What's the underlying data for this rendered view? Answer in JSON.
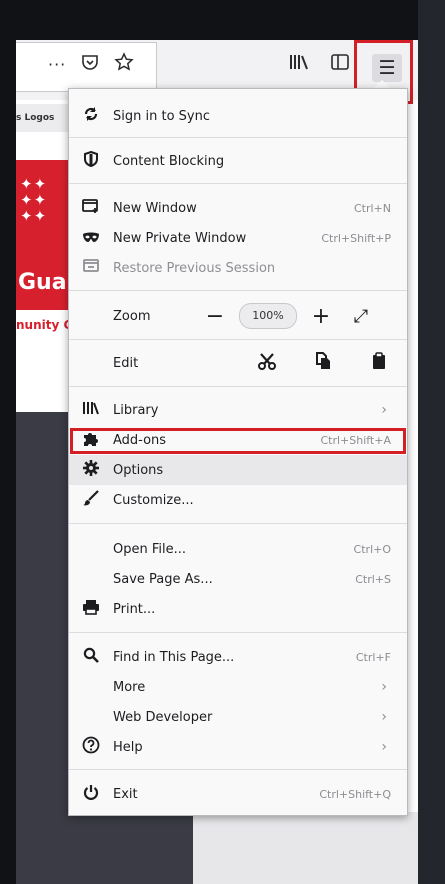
{
  "toolbar": {
    "more_glyph": "···",
    "pocket_icon": "pocket-icon",
    "bookmark_icon": "star-icon",
    "library_icon": "library-icon",
    "sidebar_icon": "sidebar-icon",
    "menu_icon": "hamburger-menu-icon"
  },
  "page": {
    "nav_text": "s  Logos",
    "logo_text": "Guar",
    "community_text": "nunity C"
  },
  "menu": {
    "sign_in": "Sign in to Sync",
    "content_blocking": "Content Blocking",
    "new_window": "New Window",
    "new_window_shortcut": "Ctrl+N",
    "new_private": "New Private Window",
    "new_private_shortcut": "Ctrl+Shift+P",
    "restore": "Restore Previous Session",
    "zoom_label": "Zoom",
    "zoom_minus": "−",
    "zoom_value": "100%",
    "zoom_plus": "+",
    "fullscreen": "⤢",
    "edit_label": "Edit",
    "library": "Library",
    "addons": "Add-ons",
    "addons_shortcut": "Ctrl+Shift+A",
    "options": "Options",
    "customize": "Customize...",
    "open_file": "Open File...",
    "open_file_shortcut": "Ctrl+O",
    "save_page": "Save Page As...",
    "save_page_shortcut": "Ctrl+S",
    "print": "Print...",
    "find": "Find in This Page...",
    "find_shortcut": "Ctrl+F",
    "more": "More",
    "web_developer": "Web Developer",
    "help": "Help",
    "exit": "Exit",
    "exit_shortcut": "Ctrl+Shift+Q",
    "chevron": "›"
  },
  "colors": {
    "highlight_red": "#d41f26",
    "brand_red": "#d6202e"
  }
}
